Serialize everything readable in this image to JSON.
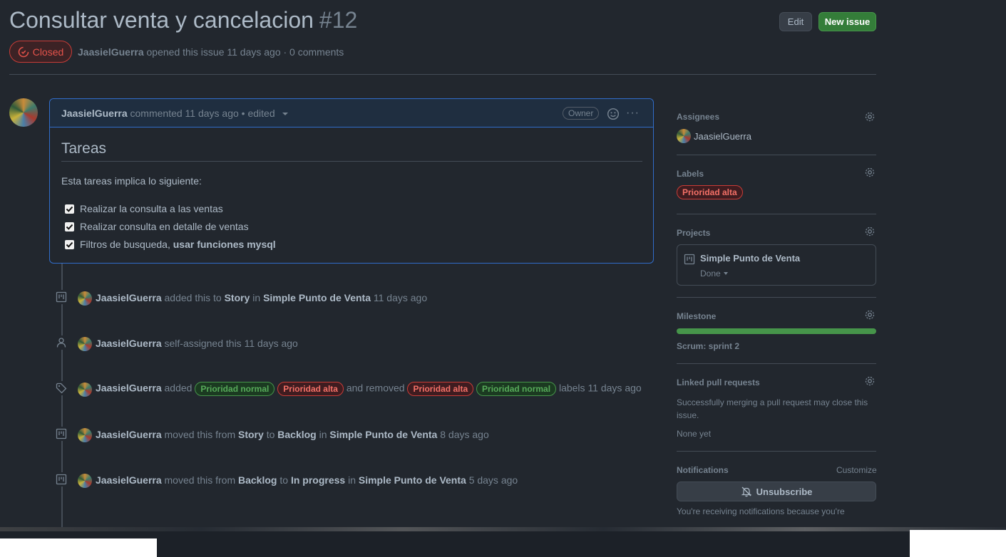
{
  "issue": {
    "title": "Consultar venta y cancelacion",
    "number": "#12",
    "state": "Closed",
    "author": "JaasielGuerra",
    "meta_text": "opened this issue 11 days ago · 0 comments"
  },
  "header": {
    "edit_label": "Edit",
    "new_issue_label": "New issue"
  },
  "comment": {
    "author": "JaasielGuerra",
    "meta": "commented 11 days ago • edited",
    "badge": "Owner",
    "more": "···",
    "heading": "Tareas",
    "intro": "Esta tareas implica lo siguiente:",
    "tasks": [
      {
        "text": "Realizar la consulta a las ventas",
        "bold": ""
      },
      {
        "text": "Realizar consulta en detalle de ventas",
        "bold": ""
      },
      {
        "text": "Filtros de busqueda, ",
        "bold": "usar funciones mysql"
      }
    ]
  },
  "timeline": {
    "e1": {
      "actor": "JaasielGuerra",
      "t1": "added this to",
      "col": "Story",
      "t2": "in",
      "project": "Simple Punto de Venta",
      "time": "11 days ago"
    },
    "e2": {
      "actor": "JaasielGuerra",
      "t1": "self-assigned this",
      "time": "11 days ago"
    },
    "e3": {
      "actor": "JaasielGuerra",
      "t1": "added",
      "l1": "Prioridad normal",
      "l2": "Prioridad alta",
      "t2": "and removed",
      "l3": "Prioridad alta",
      "l4": "Prioridad normal",
      "t3": "labels",
      "time": "11 days ago"
    },
    "e4": {
      "actor": "JaasielGuerra",
      "t1": "moved this from",
      "from": "Story",
      "t2": "to",
      "to": "Backlog",
      "t3": "in",
      "project": "Simple Punto de Venta",
      "time": "8 days ago"
    },
    "e5": {
      "actor": "JaasielGuerra",
      "t1": "moved this from",
      "from": "Backlog",
      "t2": "to",
      "to": "In progress",
      "t3": "in",
      "project": "Simple Punto de Venta",
      "time": "5 days ago"
    }
  },
  "sidebar": {
    "assignees_title": "Assignees",
    "assignee": "JaasielGuerra",
    "labels_title": "Labels",
    "label": "Prioridad alta",
    "projects_title": "Projects",
    "project_name": "Simple Punto de Venta",
    "project_status": "Done",
    "milestone_title": "Milestone",
    "milestone_progress": 1.0,
    "milestone_name": "Scrum: sprint 2",
    "linked_title": "Linked pull requests",
    "linked_desc_1": "Successfully merging a pull request may close this",
    "linked_desc_2": "issue.",
    "linked_none": "None yet",
    "notifications_title": "Notifications",
    "customize": "Customize",
    "unsubscribe": "Unsubscribe",
    "notif_reason": "You're receiving notifications because you're"
  },
  "colors": {
    "accent": "#316dca",
    "closed": "#e5534b",
    "success": "#46954a"
  }
}
